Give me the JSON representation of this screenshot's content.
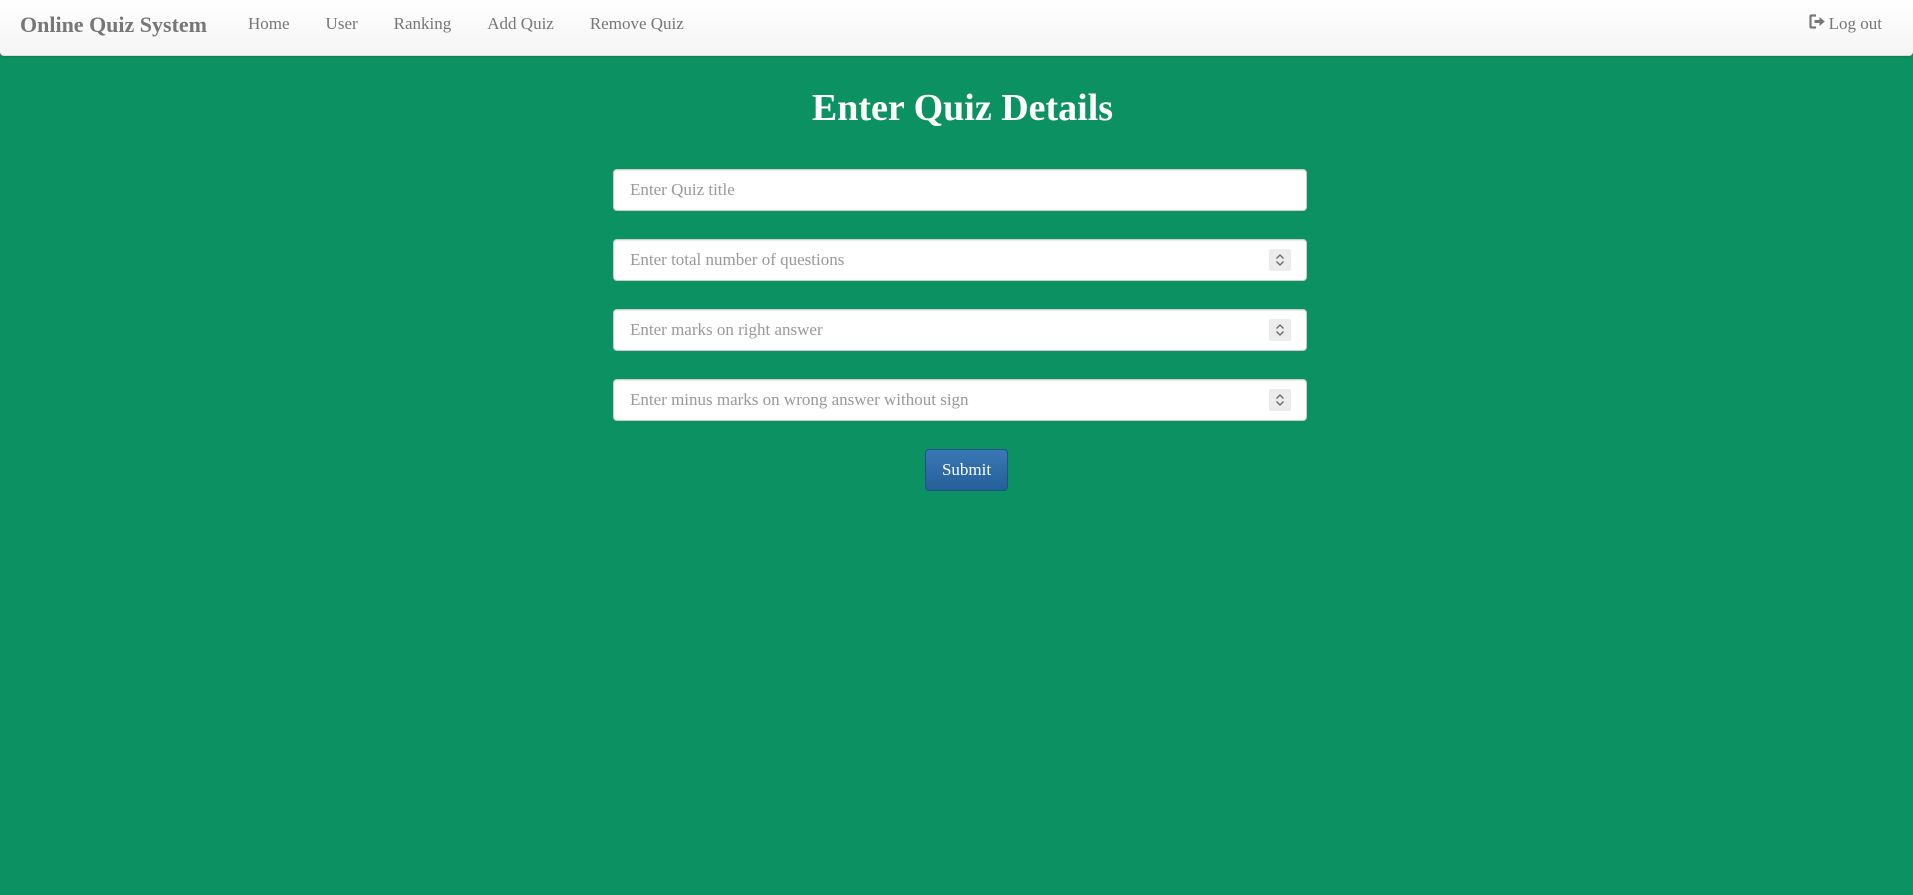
{
  "navbar": {
    "brand": "Online Quiz System",
    "items": [
      {
        "label": "Home"
      },
      {
        "label": "User"
      },
      {
        "label": "Ranking"
      },
      {
        "label": "Add Quiz"
      },
      {
        "label": "Remove Quiz"
      }
    ],
    "logout_label": "Log out"
  },
  "main": {
    "heading": "Enter Quiz Details",
    "fields": [
      {
        "placeholder": "Enter Quiz title",
        "type": "text"
      },
      {
        "placeholder": "Enter total number of questions",
        "type": "number"
      },
      {
        "placeholder": "Enter marks on right answer",
        "type": "number"
      },
      {
        "placeholder": "Enter minus marks on wrong answer without sign",
        "type": "number"
      }
    ],
    "submit_label": "Submit"
  },
  "colors": {
    "background": "#0c9162",
    "navbar": "#f8f8f8",
    "nav_text": "#777777",
    "primary_button": "#2e6da4"
  }
}
